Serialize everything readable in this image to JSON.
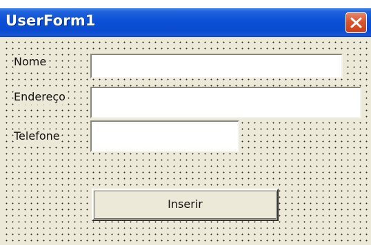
{
  "window": {
    "title": "UserForm1"
  },
  "title_bar_buttons": {
    "close_icon": "close-icon"
  },
  "form": {
    "fields": [
      {
        "label": "Nome",
        "value": ""
      },
      {
        "label": "Endereço",
        "value": ""
      },
      {
        "label": "Telefone",
        "value": ""
      }
    ],
    "submit_label": "Inserir"
  },
  "colors": {
    "title_bar": "#0a4bd0",
    "close_button": "#d9542b",
    "client_background": "#ece9d8"
  }
}
